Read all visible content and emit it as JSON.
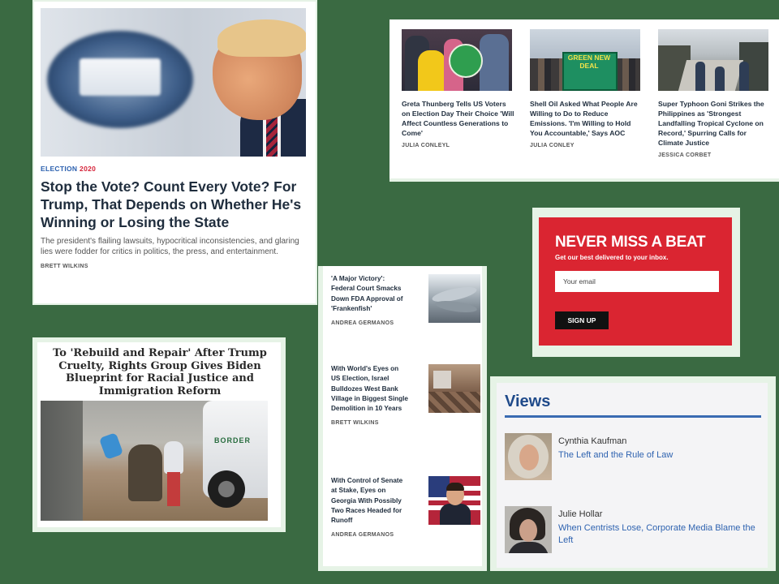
{
  "hero": {
    "kicker_prefix": "ELECTION ",
    "kicker_year": "2020",
    "title": "Stop the Vote? Count Every Vote? For Trump, That Depends on Whether He's Winning or Losing the State",
    "dek": "The president's flailing lawsuits, hypocritical inconsistencies, and glaring lies were fodder for critics in politics, the press, and entertainment.",
    "byline": "BRETT WILKINS"
  },
  "top_stories": [
    {
      "title": "Greta Thunberg Tells US Voters on Election Day Their Choice 'Will Affect Countless Generations to Come'",
      "byline": "JULIA CONLEYL"
    },
    {
      "title": "Shell Oil Asked What People Are Willing to Do to Reduce Emissions. 'I'm Willing to Hold You Accountable,' Says AOC",
      "byline": "JULIA CONLEY",
      "sign_text": "GREEN NEW DEAL"
    },
    {
      "title": "Super Typhoon Goni Strikes the Philippines as 'Strongest Landfalling Tropical Cyclone on Record,' Spurring Calls for Climate Justice",
      "byline": "JESSICA CORBET"
    }
  ],
  "newsletter": {
    "title": "NEVER MISS A BEAT",
    "subtitle": "Get our best delivered to your inbox.",
    "email_placeholder": "Your email",
    "button_label": "SIGN UP"
  },
  "mid_stories": [
    {
      "title": "'A Major Victory': Federal Court Smacks Down FDA Approval of 'Frankenfish'",
      "byline": "ANDREA GERMANOS"
    },
    {
      "title": "With World's Eyes on US Election, Israel Bulldozes West Bank Village in Biggest Single Demolition in 10 Years",
      "byline": "BRETT WILKINS"
    },
    {
      "title": "With Control of Senate at Stake, Eyes on Georgia With Possibly Two Races Headed for Runoff",
      "byline": "ANDREA GERMANOS"
    }
  ],
  "immigration": {
    "title": "To 'Rebuild and Repair' After Trump Cruelty, Rights Group Gives Biden Blueprint for Racial Justice and Immigration Reform",
    "truck_text": "BORDER"
  },
  "views": {
    "heading": "Views",
    "items": [
      {
        "author": "Cynthia Kaufman",
        "headline": "The Left and the Rule of Law"
      },
      {
        "author": "Julie Hollar",
        "headline": "When Centrists Lose, Corporate Media Blame the Left"
      }
    ]
  },
  "colors": {
    "background": "#3a6a42",
    "frame": "#e6f3e6",
    "accent_red": "#da2531",
    "link_blue": "#2f63b0"
  }
}
